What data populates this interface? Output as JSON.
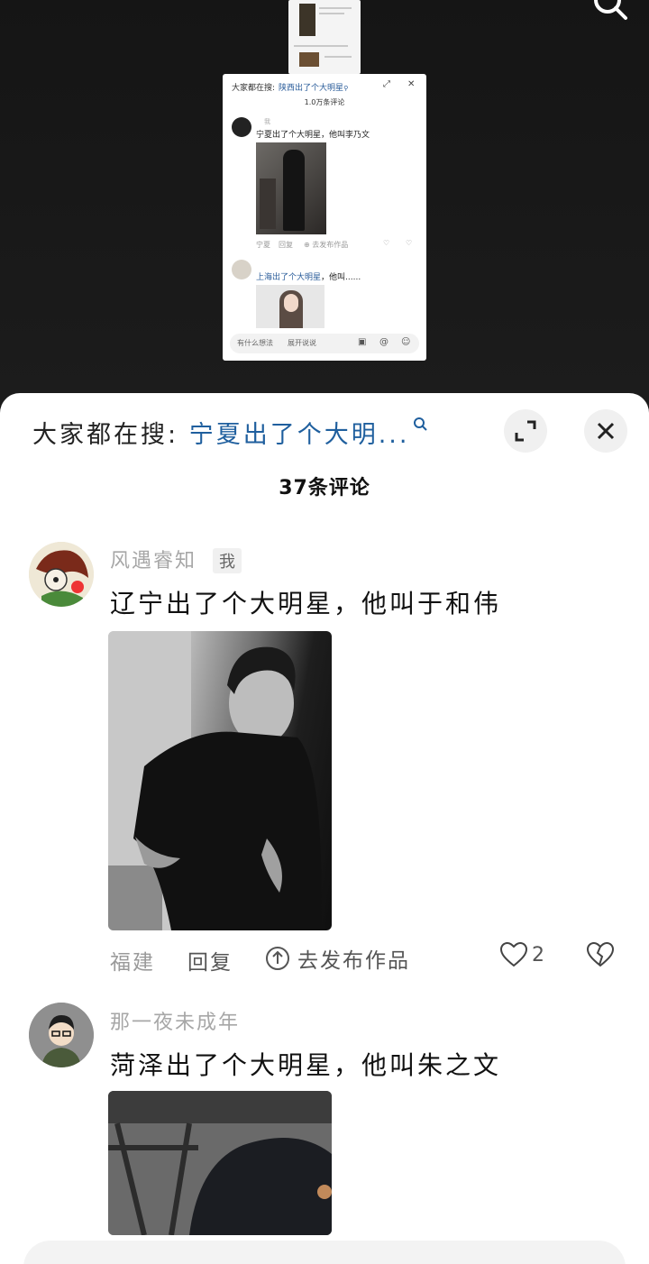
{
  "mini_preview": {
    "search_prefix": "大家都在搜:",
    "search_keyword": "陕西出了个大明星",
    "comment_count": "1.0万条评论",
    "comment1": {
      "username": "",
      "me_tag": "我",
      "text": "宁夏出了个大明星，他叫李乃文",
      "location": "宁夏",
      "reply": "回复",
      "publish": "去发布作品"
    },
    "comment2": {
      "username": "",
      "text": "上海出了个大明星",
      "text_tail": "，他叫......"
    },
    "input_placeholder": "有什么想法",
    "input_hint": "展开说说"
  },
  "sheet": {
    "search_prefix": "大家都在搜:",
    "search_keyword": "宁夏出了个大明...",
    "comment_count": "37条评论",
    "comments": [
      {
        "username": "风遇睿知",
        "me_tag": "我",
        "text": "辽宁出了个大明星，他叫于和伟",
        "location": "福建",
        "reply": "回复",
        "publish": "去发布作品",
        "likes": "2"
      },
      {
        "username": "那一夜未成年",
        "text": "菏泽出了个大明星，他叫朱之文"
      }
    ]
  },
  "icons": {
    "top_search": "search-icon",
    "expand": "expand-icon",
    "close": "close-icon",
    "like": "heart-icon",
    "dislike": "broken-heart-icon",
    "publish": "upload-circle-icon"
  },
  "colors": {
    "keyword_blue": "#1f5f9e",
    "backdrop": "#151515",
    "sheet": "#ffffff"
  }
}
